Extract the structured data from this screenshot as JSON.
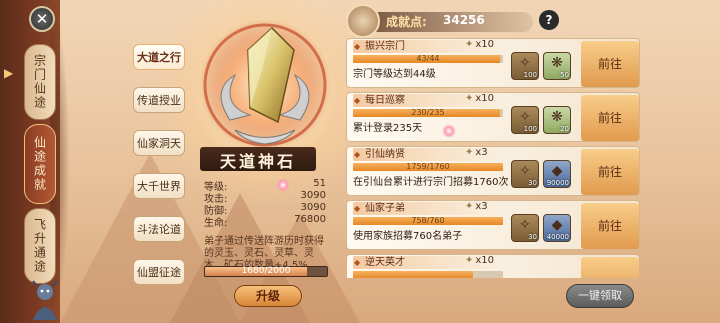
{
  "nav": {
    "tabs": [
      {
        "label": "宗门仙途",
        "active": false
      },
      {
        "label": "仙途成就",
        "active": true
      },
      {
        "label": "飞升通途",
        "active": false
      }
    ]
  },
  "subtabs": [
    {
      "label": "大道之行",
      "selected": true
    },
    {
      "label": "传道授业",
      "selected": false
    },
    {
      "label": "仙家洞天",
      "selected": false
    },
    {
      "label": "大千世界",
      "selected": false
    },
    {
      "label": "斗法论道",
      "selected": false
    },
    {
      "label": "仙盟征途",
      "selected": false
    }
  ],
  "artifact": {
    "name": "天道神石",
    "stats": [
      {
        "key": "等级:",
        "value": "51"
      },
      {
        "key": "攻击:",
        "value": "3090"
      },
      {
        "key": "防御:",
        "value": "3090"
      },
      {
        "key": "生命:",
        "value": "76800"
      }
    ],
    "description": "弟子通过传送阵游历时获得的灵玉、灵石、灵草、灵木、矿石的数量+4.5%",
    "progress_text": "1680/2000",
    "progress": 0.84,
    "upgrade_label": "升级"
  },
  "header": {
    "points_label": "成就点:",
    "points_value": "34256",
    "help": "?"
  },
  "tasks": [
    {
      "title": "振兴宗门",
      "reward": "x10",
      "progress_text": "43/44",
      "progress": 0.977,
      "desc": "宗门等级达到44级",
      "items": [
        {
          "count": "100",
          "kind": "brown"
        },
        {
          "count": "50",
          "kind": "green"
        }
      ],
      "button": "前往"
    },
    {
      "title": "每日巡察",
      "reward": "x10",
      "progress_text": "230/235",
      "progress": 0.979,
      "desc": "累计登录235天",
      "items": [
        {
          "count": "100",
          "kind": "brown"
        },
        {
          "count": "20",
          "kind": "green"
        }
      ],
      "button": "前往"
    },
    {
      "title": "引仙纳贤",
      "reward": "x3",
      "progress_text": "1759/1760",
      "progress": 0.999,
      "desc": "在引仙台累计进行宗门招募1760次",
      "items": [
        {
          "count": "30",
          "kind": "brown"
        },
        {
          "count": "90000",
          "kind": "blue"
        }
      ],
      "button": "前往"
    },
    {
      "title": "仙家子弟",
      "reward": "x3",
      "progress_text": "758/760",
      "progress": 0.997,
      "desc": "使用家族招募760名弟子",
      "items": [
        {
          "count": "30",
          "kind": "brown"
        },
        {
          "count": "40000",
          "kind": "blue"
        }
      ],
      "button": "前往"
    },
    {
      "title": "逆天英才",
      "reward": "x10",
      "progress_text": "",
      "progress": 0.8,
      "desc": "",
      "items": [],
      "button": ""
    }
  ],
  "collect_all": "一键领取"
}
